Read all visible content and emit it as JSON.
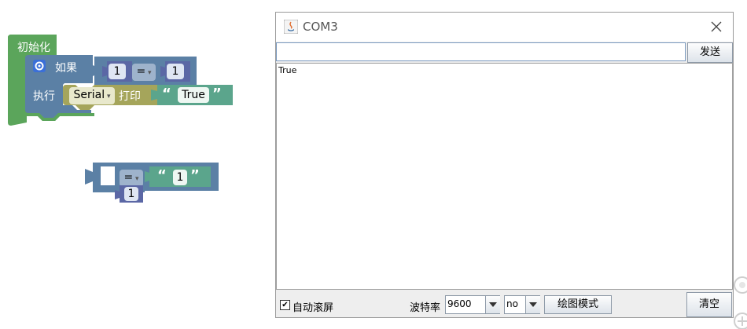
{
  "blocks": {
    "init_label": "初始化",
    "if_label": "如果",
    "do_label": "执行",
    "cond_left": "1",
    "cond_op": "=",
    "cond_right": "1",
    "serial_dropdown": "Serial",
    "print_label": "打印",
    "print_text": "True",
    "quote_open": "“",
    "quote_close": "”",
    "loose_op": "=",
    "loose_text": "1",
    "loose_num": "1"
  },
  "serial_monitor": {
    "title": "COM3",
    "send_input_value": "",
    "send_button": "发送",
    "output_text": "True",
    "autoscroll_label": "自动滚屏",
    "autoscroll_checked": "✔",
    "baud_label": "波特率",
    "baud_value": "9600",
    "line_ending_value": "no",
    "plot_button": "绘图模式",
    "clear_button": "清空"
  },
  "colors": {
    "init_block": "#5ba55b",
    "logic_block": "#5b80a5",
    "serial_block": "#a5a55b",
    "text_block": "#5ba58c"
  }
}
